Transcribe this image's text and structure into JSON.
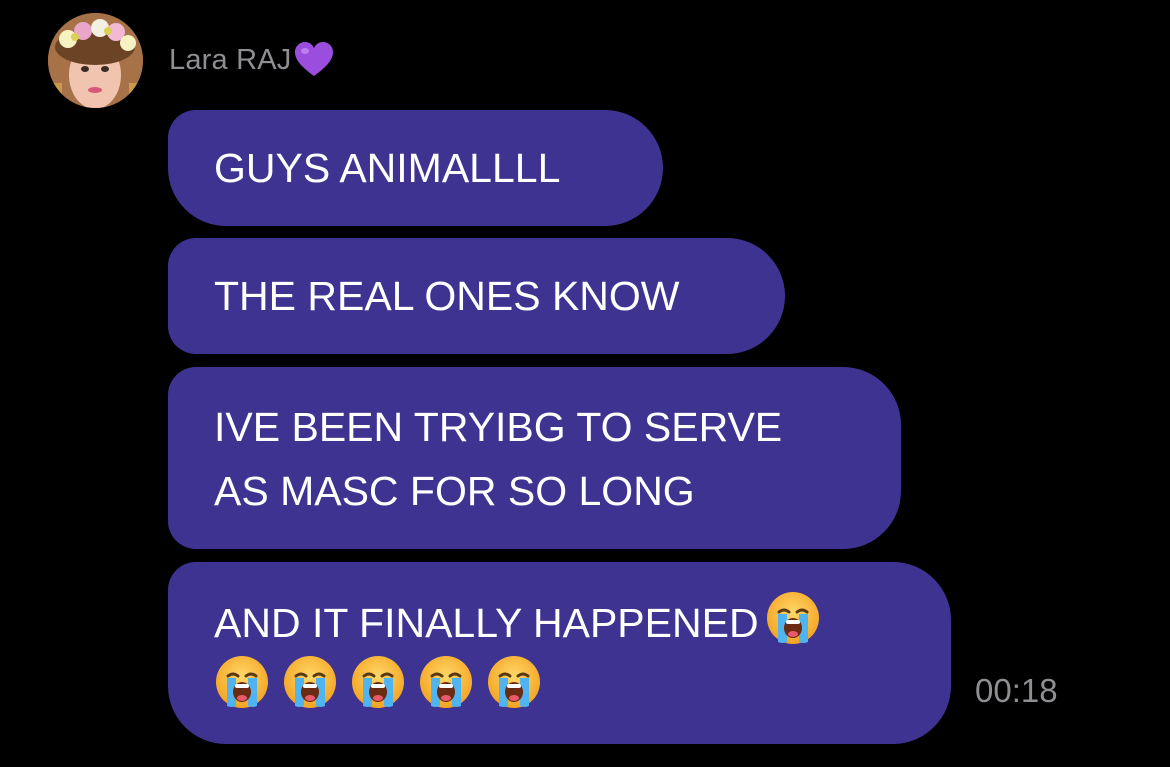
{
  "sender": {
    "name": "Lara RAJ",
    "name_icon": "purple-heart-icon",
    "avatar_icon": "flower-crown-avatar"
  },
  "messages": [
    {
      "lines": [
        "GUYS ANIMALLLL"
      ]
    },
    {
      "lines": [
        "THE REAL ONES KNOW"
      ]
    },
    {
      "lines": [
        "IVE BEEN TRYIBG TO SERVE",
        "AS MASC FOR SO LONG"
      ]
    },
    {
      "lines": [
        "AND IT FINALLY HAPPENED"
      ],
      "trailing_emoji_count": 6,
      "emoji": "loudly-crying-face-icon"
    }
  ],
  "timestamp": "00:18",
  "colors": {
    "background": "#000000",
    "bubble": "#3f3391",
    "text": "#ffffff",
    "meta": "#8e8e93",
    "heart": "#9b4dde"
  }
}
